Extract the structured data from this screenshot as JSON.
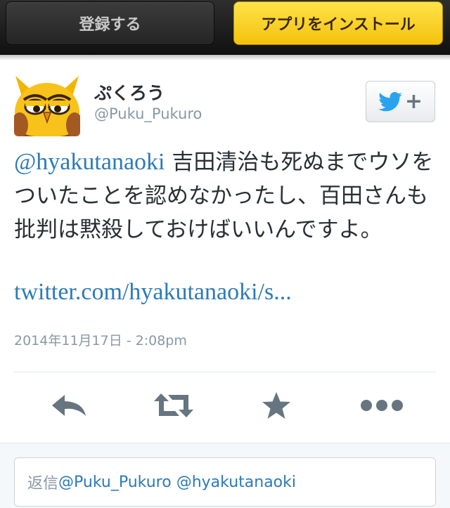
{
  "topbar": {
    "register_label": "登録する",
    "install_label": "アプリをインストール"
  },
  "tweet": {
    "display_name": "ぷくろう",
    "screen_name": "@Puku_Pukuro",
    "mention": "@hyakutanaoki",
    "body": " 吉田清治も死ぬまでウソをついたことを認めなかったし、百田さんも批判は黙殺しておけばいいんですよ。",
    "link": "twitter.com/hyakutanaoki/s...",
    "timestamp": "2014年11月17日 - 2:08pm"
  },
  "follow_button": {
    "icon": "twitter-bird-icon",
    "plus": "+"
  },
  "actions": [
    "reply-icon",
    "retweet-icon",
    "favorite-icon",
    "more-icon"
  ],
  "reply": {
    "prefix": "返信",
    "handles": "@Puku_Pukuro @hyakutanaoki"
  },
  "colors": {
    "link": "#2b7bb9",
    "install_button": "#f4c20d",
    "muted": "#8899a6",
    "twitter_blue": "#2aa3ef"
  }
}
